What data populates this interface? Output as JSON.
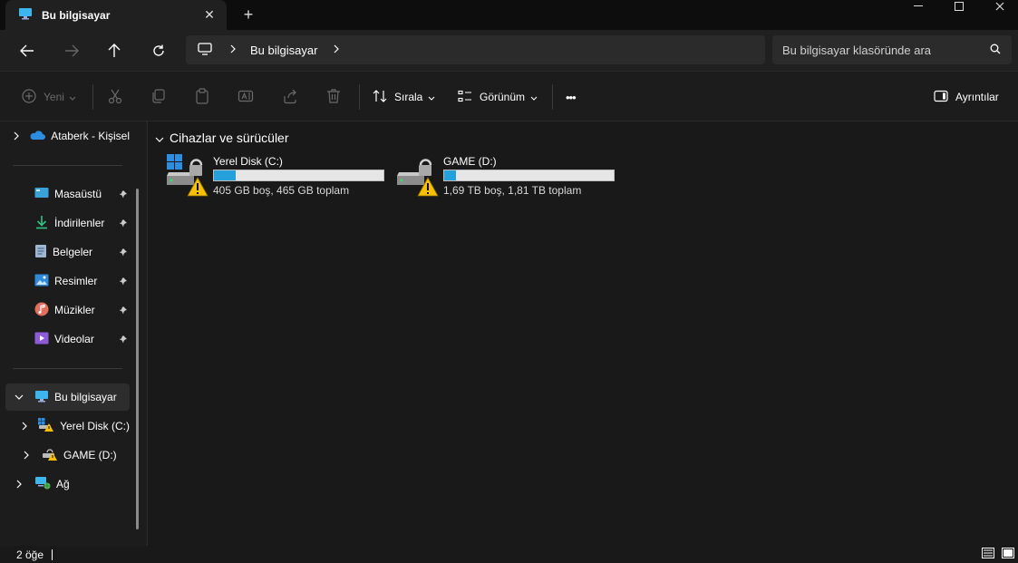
{
  "window": {
    "tab_title": "Bu bilgisayar",
    "new_tab": "+",
    "close_tab": "✕",
    "minimize": "—",
    "maximize": "☐",
    "close": "✕"
  },
  "address": {
    "path": [
      "Bu bilgisayar"
    ],
    "search_placeholder": "Bu bilgisayar klasöründe ara"
  },
  "toolbar": {
    "new_label": "Yeni",
    "sort_label": "Sırala",
    "view_label": "Görünüm",
    "more_label": "•••",
    "details_label": "Ayrıntılar"
  },
  "sidebar": {
    "cloud": {
      "label": "Ataberk - Kişisel",
      "icon": "onedrive-icon"
    },
    "quick_access": [
      {
        "label": "Masaüstü",
        "icon": "desktop-icon",
        "pinned": true
      },
      {
        "label": "İndirilenler",
        "icon": "download-icon",
        "pinned": true
      },
      {
        "label": "Belgeler",
        "icon": "documents-icon",
        "pinned": true
      },
      {
        "label": "Resimler",
        "icon": "pictures-icon",
        "pinned": true
      },
      {
        "label": "Müzikler",
        "icon": "music-icon",
        "pinned": true
      },
      {
        "label": "Videolar",
        "icon": "videos-icon",
        "pinned": true
      }
    ],
    "this_pc": {
      "label": "Bu bilgisayar",
      "icon": "computer-icon",
      "expanded": true
    },
    "drives": [
      {
        "label": "Yerel Disk (C:)"
      },
      {
        "label": "GAME (D:)"
      }
    ],
    "network": {
      "label": "Ağ",
      "icon": "network-icon"
    }
  },
  "main": {
    "group_title": "Cihazlar ve sürücüler",
    "drives": [
      {
        "name": "Yerel Disk (C:)",
        "free_text": "405 GB boş, 465 GB toplam",
        "used_fraction": 0.13,
        "windows": true
      },
      {
        "name": "GAME (D:)",
        "free_text": "1,69 TB boş, 1,81 TB toplam",
        "used_fraction": 0.07,
        "windows": false
      }
    ]
  },
  "status": {
    "item_count": "2 öğe"
  },
  "colors": {
    "accent": "#26a0da",
    "warning": "#f7c000"
  }
}
